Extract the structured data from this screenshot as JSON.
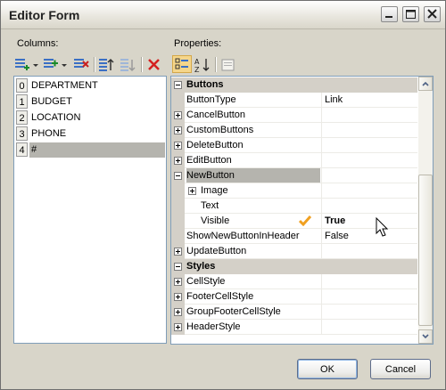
{
  "window": {
    "title": "Editor Form"
  },
  "title_buttons": [
    "minimize-icon",
    "maximize-icon",
    "close-icon"
  ],
  "columns": {
    "label": "Columns:",
    "toolbar_icons": [
      "add-column-icon",
      "insert-column-icon",
      "delete-column-icon",
      "move-up-icon",
      "move-down-icon",
      "remove-icon"
    ],
    "items": [
      {
        "index": "0",
        "name": "DEPARTMENT"
      },
      {
        "index": "1",
        "name": "BUDGET"
      },
      {
        "index": "2",
        "name": "LOCATION"
      },
      {
        "index": "3",
        "name": "PHONE"
      },
      {
        "index": "4",
        "name": "#"
      }
    ],
    "selected_index": 4
  },
  "properties": {
    "label": "Properties:",
    "toolbar_icons": [
      "categorized-icon",
      "alphabetical-icon",
      "property-pages-icon"
    ],
    "rows": [
      {
        "type": "category",
        "name": "Buttons",
        "value": ""
      },
      {
        "type": "prop",
        "name": "ButtonType",
        "value": "Link"
      },
      {
        "type": "prop",
        "name": "CancelButton",
        "value": ""
      },
      {
        "type": "prop",
        "name": "CustomButtons",
        "value": ""
      },
      {
        "type": "prop",
        "name": "DeleteButton",
        "value": ""
      },
      {
        "type": "prop",
        "name": "EditButton",
        "value": ""
      },
      {
        "type": "prop",
        "name": "NewButton",
        "value": ""
      },
      {
        "type": "prop",
        "name": "Image",
        "value": ""
      },
      {
        "type": "prop",
        "name": "Text",
        "value": ""
      },
      {
        "type": "prop",
        "name": "Visible",
        "value": "True"
      },
      {
        "type": "prop",
        "name": "ShowNewButtonInHeader",
        "value": "False"
      },
      {
        "type": "prop",
        "name": "UpdateButton",
        "value": ""
      },
      {
        "type": "category",
        "name": "Styles",
        "value": ""
      },
      {
        "type": "prop",
        "name": "CellStyle",
        "value": ""
      },
      {
        "type": "prop",
        "name": "FooterCellStyle",
        "value": ""
      },
      {
        "type": "prop",
        "name": "GroupFooterCellStyle",
        "value": ""
      },
      {
        "type": "prop",
        "name": "HeaderStyle",
        "value": ""
      }
    ]
  },
  "buttons": {
    "ok": "OK",
    "cancel": "Cancel"
  },
  "colors": {
    "accent_check": "#f0a020",
    "selection": "#b5b4ae",
    "category_bg": "#d4d0c8"
  }
}
